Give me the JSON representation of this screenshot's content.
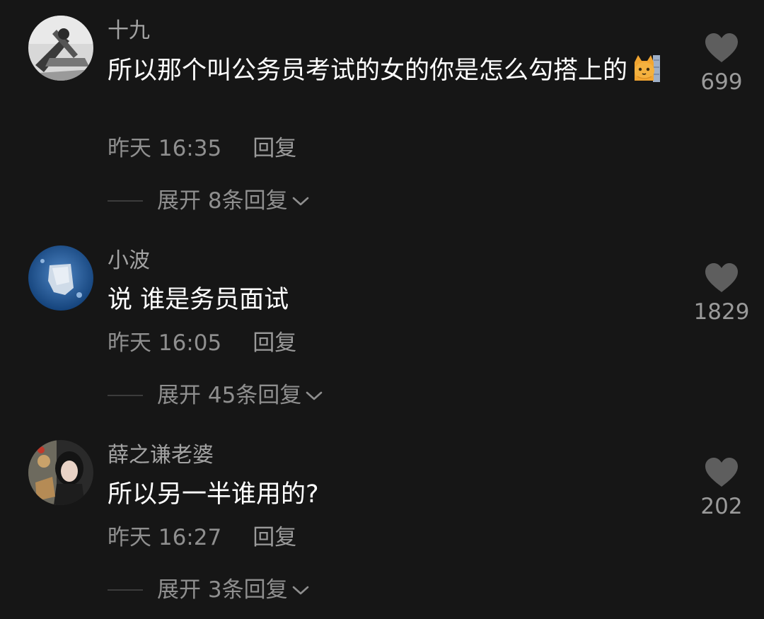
{
  "comments": [
    {
      "username": "十九",
      "text": "所以那个叫公务员考试的女的你是怎么勾搭上的",
      "emoji": "cat-peeking-emoji",
      "time": "昨天 16:35",
      "reply_label": "回复",
      "expand_label": "展开 8条回复",
      "likes": "699"
    },
    {
      "username": "小波",
      "text": "说 谁是务员面试",
      "time": "昨天 16:05",
      "reply_label": "回复",
      "expand_label": "展开 45条回复",
      "likes": "1829"
    },
    {
      "username": "薛之谦老婆",
      "text": "所以另一半谁用的?",
      "time": "昨天 16:27",
      "reply_label": "回复",
      "expand_label": "展开 3条回复",
      "likes": "202"
    }
  ],
  "colors": {
    "background": "#161616",
    "username": "#a3a3a3",
    "text": "#ffffff",
    "meta": "#8f8f8f",
    "heart": "#5e5e5e"
  },
  "icons": {
    "like": "heart-icon",
    "expand": "chevron-down-icon"
  }
}
